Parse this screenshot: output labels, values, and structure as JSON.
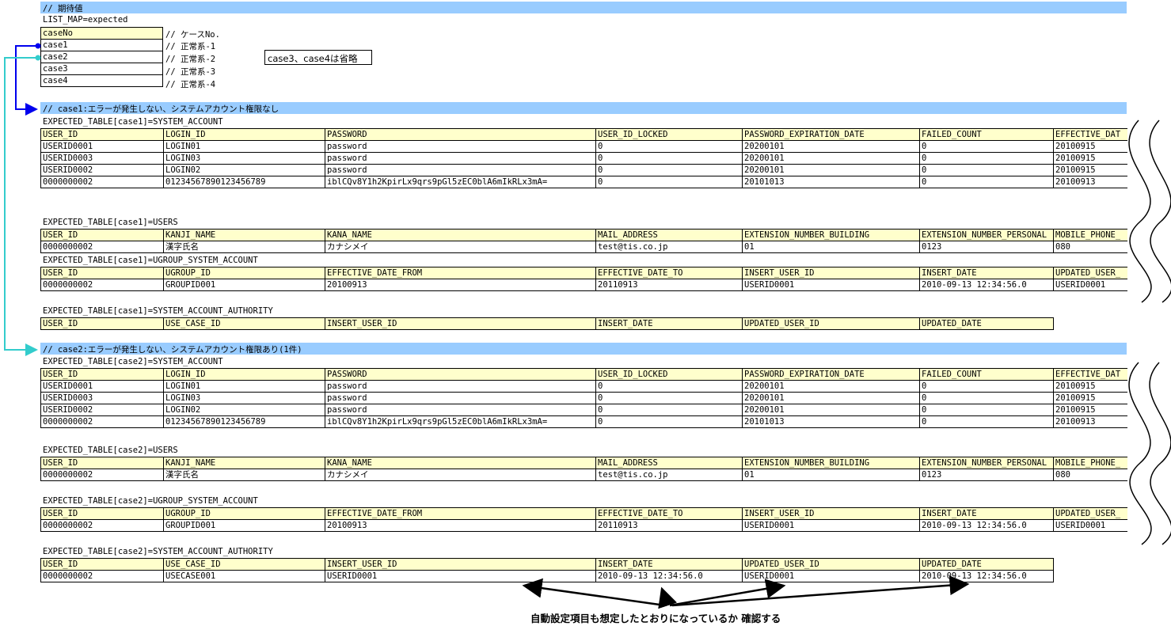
{
  "header_bar": "// 期待値",
  "list_map_label": "LIST_MAP=expected",
  "list_map": [
    {
      "key": "caseNo",
      "comment": "// ケースNo."
    },
    {
      "key": "case1",
      "comment": "// 正常系-1"
    },
    {
      "key": "case2",
      "comment": "// 正常系-2"
    },
    {
      "key": "case3",
      "comment": "// 正常系-3"
    },
    {
      "key": "case4",
      "comment": "// 正常系-4"
    }
  ],
  "note": "case3、case4は省略",
  "sections": [
    {
      "title": "// case1:エラーが発生しない、システムアカウント権限なし",
      "tables": [
        {
          "label": "EXPECTED_TABLE[case1]=SYSTEM_ACCOUNT",
          "headers": [
            "USER_ID",
            "LOGIN_ID",
            "PASSWORD",
            "USER_ID_LOCKED",
            "PASSWORD_EXPIRATION_DATE",
            "FAILED_COUNT",
            "EFFECTIVE_DAT"
          ],
          "rows": [
            [
              "USERID0001",
              "LOGIN01",
              "password",
              "0",
              "20200101",
              "0",
              "20100915"
            ],
            [
              "USERID0003",
              "LOGIN03",
              "password",
              "0",
              "20200101",
              "0",
              "20100915"
            ],
            [
              "USERID0002",
              "LOGIN02",
              "password",
              "0",
              "20200101",
              "0",
              "20100915"
            ],
            [
              "0000000002",
              "01234567890123456789",
              "iblCQv8Y1h2KpirLx9qrs9pGl5zEC0blA6mIkRLx3mA=",
              "0",
              "20101013",
              "0",
              "20100913"
            ]
          ]
        },
        {
          "label": "EXPECTED_TABLE[case1]=USERS",
          "headers": [
            "USER_ID",
            "KANJI_NAME",
            "KANA_NAME",
            "MAIL_ADDRESS",
            "EXTENSION_NUMBER_BUILDING",
            "EXTENSION_NUMBER_PERSONAL",
            "MOBILE_PHONE_"
          ],
          "rows": [
            [
              "0000000002",
              "漢字氏名",
              "カナシメイ",
              "test@tis.co.jp",
              "01",
              "0123",
              "080"
            ]
          ]
        },
        {
          "label": "EXPECTED_TABLE[case1]=UGROUP_SYSTEM_ACCOUNT",
          "headers": [
            "USER_ID",
            "UGROUP_ID",
            "EFFECTIVE_DATE_FROM",
            "EFFECTIVE_DATE_TO",
            "INSERT_USER_ID",
            "INSERT_DATE",
            "UPDATED_USER_"
          ],
          "rows": [
            [
              "0000000002",
              "GROUPID001",
              "20100913",
              "20110913",
              "USERID0001",
              "2010-09-13 12:34:56.0",
              "USERID0001"
            ]
          ]
        },
        {
          "label": "EXPECTED_TABLE[case1]=SYSTEM_ACCOUNT_AUTHORITY",
          "headers": [
            "USER_ID",
            "USE_CASE_ID",
            "INSERT_USER_ID",
            "INSERT_DATE",
            "UPDATED_USER_ID",
            "UPDATED_DATE"
          ],
          "rows": []
        }
      ]
    },
    {
      "title": "// case2:エラーが発生しない、システムアカウント権限あり(1件)",
      "tables": [
        {
          "label": "EXPECTED_TABLE[case2]=SYSTEM_ACCOUNT",
          "headers": [
            "USER_ID",
            "LOGIN_ID",
            "PASSWORD",
            "USER_ID_LOCKED",
            "PASSWORD_EXPIRATION_DATE",
            "FAILED_COUNT",
            "EFFECTIVE_DAT"
          ],
          "rows": [
            [
              "USERID0001",
              "LOGIN01",
              "password",
              "0",
              "20200101",
              "0",
              "20100915"
            ],
            [
              "USERID0003",
              "LOGIN03",
              "password",
              "0",
              "20200101",
              "0",
              "20100915"
            ],
            [
              "USERID0002",
              "LOGIN02",
              "password",
              "0",
              "20200101",
              "0",
              "20100915"
            ],
            [
              "0000000002",
              "01234567890123456789",
              "iblCQv8Y1h2KpirLx9qrs9pGl5zEC0blA6mIkRLx3mA=",
              "0",
              "20101013",
              "0",
              "20100913"
            ]
          ]
        },
        {
          "label": "EXPECTED_TABLE[case2]=USERS",
          "headers": [
            "USER_ID",
            "KANJI_NAME",
            "KANA_NAME",
            "MAIL_ADDRESS",
            "EXTENSION_NUMBER_BUILDING",
            "EXTENSION_NUMBER_PERSONAL",
            "MOBILE_PHONE_"
          ],
          "rows": [
            [
              "0000000002",
              "漢字氏名",
              "カナシメイ",
              "test@tis.co.jp",
              "01",
              "0123",
              "080"
            ]
          ]
        },
        {
          "label": "EXPECTED_TABLE[case2]=UGROUP_SYSTEM_ACCOUNT",
          "headers": [
            "USER_ID",
            "UGROUP_ID",
            "EFFECTIVE_DATE_FROM",
            "EFFECTIVE_DATE_TO",
            "INSERT_USER_ID",
            "INSERT_DATE",
            "UPDATED_USER_"
          ],
          "rows": [
            [
              "0000000002",
              "GROUPID001",
              "20100913",
              "20110913",
              "USERID0001",
              "2010-09-13 12:34:56.0",
              "USERID0001"
            ]
          ]
        },
        {
          "label": "EXPECTED_TABLE[case2]=SYSTEM_ACCOUNT_AUTHORITY",
          "headers": [
            "USER_ID",
            "USE_CASE_ID",
            "INSERT_USER_ID",
            "INSERT_DATE",
            "UPDATED_USER_ID",
            "UPDATED_DATE"
          ],
          "rows": [
            [
              "0000000002",
              "USECASE001",
              "USERID0001",
              "2010-09-13 12:34:56.0",
              "USERID0001",
              "2010-09-13 12:34:56.0"
            ]
          ]
        }
      ]
    }
  ],
  "caption": "自動設定項目も想定したとおりになっているか 確認する",
  "colors": {
    "section_bar": "#99ccff",
    "header_cell": "#ffffcc",
    "case1_arrow": "#0000ee",
    "case2_arrow": "#33cccc"
  }
}
